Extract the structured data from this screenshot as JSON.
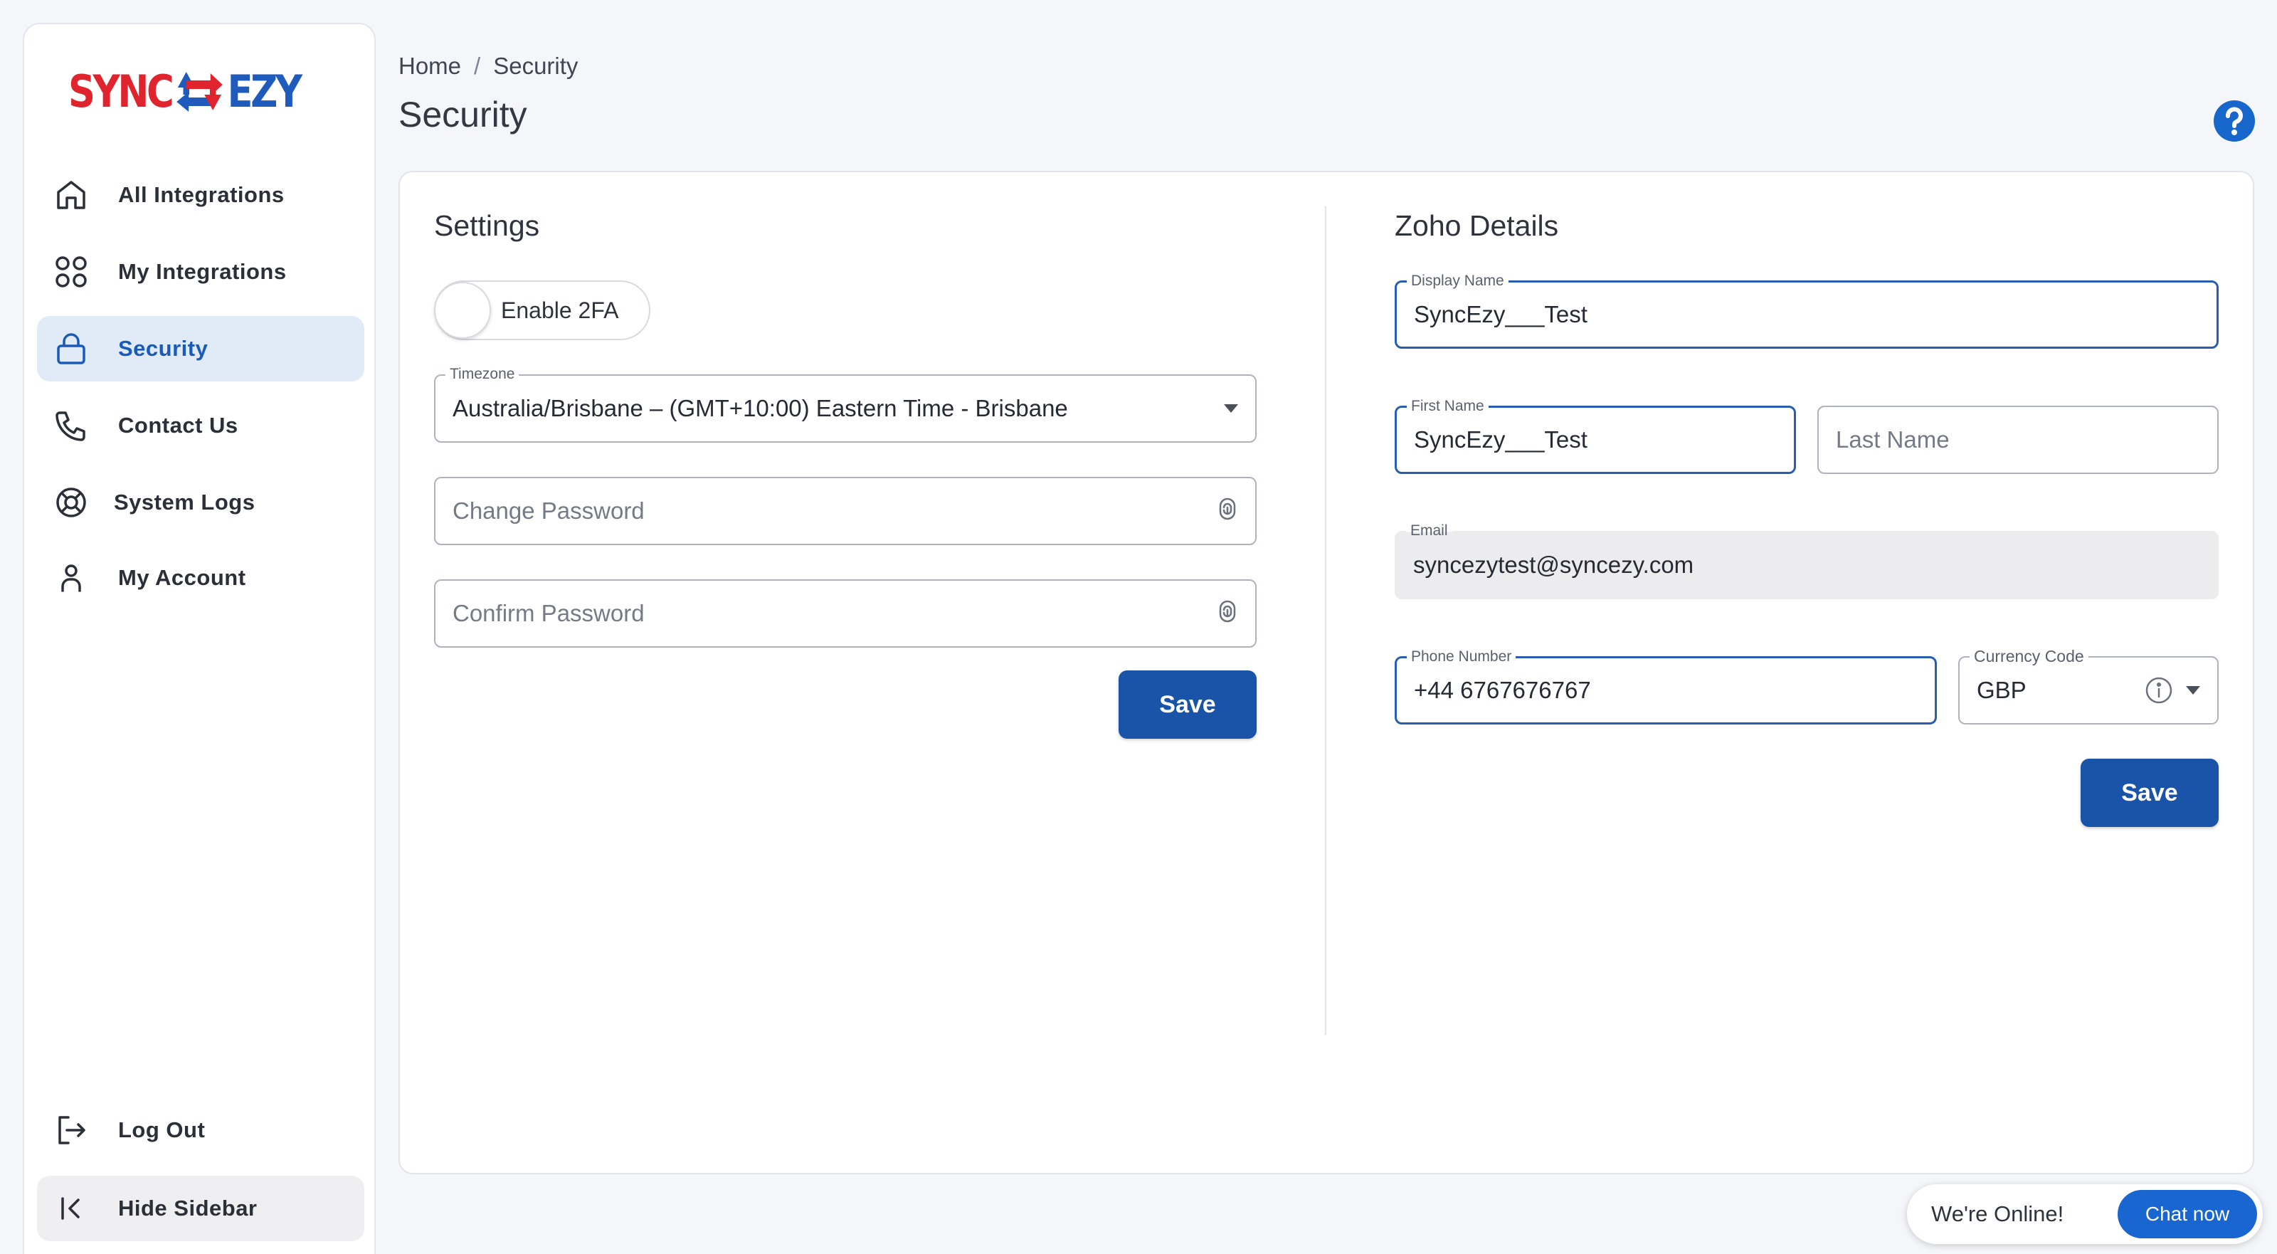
{
  "brand": {
    "logo_left": "SYNC",
    "logo_right": "EZY",
    "colors": {
      "red": "#e0242d",
      "blue": "#1f5bbd",
      "accent": "#1a54a8"
    }
  },
  "sidebar": {
    "items": [
      {
        "label": "All Integrations",
        "icon": "home-icon"
      },
      {
        "label": "My Integrations",
        "icon": "grid-icon"
      },
      {
        "label": "Security",
        "icon": "lock-icon",
        "active": true
      },
      {
        "label": "Contact Us",
        "icon": "phone-icon"
      },
      {
        "label": "System Logs",
        "icon": "lifebuoy-icon"
      },
      {
        "label": "My Account",
        "icon": "user-icon"
      }
    ],
    "logout_label": "Log Out",
    "hide_label": "Hide Sidebar"
  },
  "header": {
    "breadcrumb": [
      "Home",
      "Security"
    ],
    "breadcrumb_separator": "/",
    "title": "Security"
  },
  "settings": {
    "title": "Settings",
    "enable_2fa_label": "Enable 2FA",
    "enable_2fa_on": false,
    "timezone_label": "Timezone",
    "timezone_value": "Australia/Brisbane – (GMT+10:00) Eastern Time - Brisbane",
    "change_password_placeholder": "Change Password",
    "confirm_password_placeholder": "Confirm Password",
    "save_label": "Save"
  },
  "zoho": {
    "title": "Zoho Details",
    "display_name_label": "Display Name",
    "display_name_value": "SyncEzy___Test",
    "first_name_label": "First Name",
    "first_name_value": "SyncEzy___Test",
    "last_name_placeholder": "Last Name",
    "email_label": "Email",
    "email_value": "syncezytest@syncezy.com",
    "phone_label": "Phone Number",
    "phone_value": "+44 6767676767",
    "currency_label": "Currency Code",
    "currency_value": "GBP",
    "save_label": "Save"
  },
  "chat": {
    "status": "We're Online!",
    "button": "Chat now"
  }
}
